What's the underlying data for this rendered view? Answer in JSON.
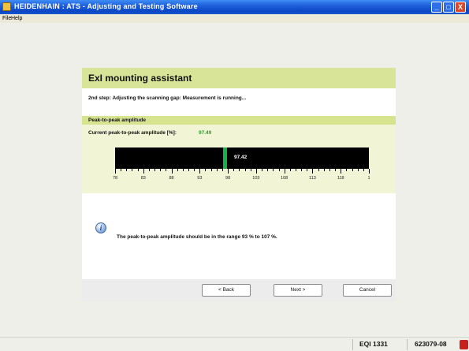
{
  "window": {
    "title": "HEIDENHAIN : ATS - Adjusting and Testing Software",
    "controls": {
      "minimize": "_",
      "maximize": "□",
      "close": "X"
    }
  },
  "menu": {
    "items": [
      "File",
      "Help"
    ]
  },
  "dialog": {
    "title": "ExI mounting assistant",
    "step_text": "2nd step: Adjusting the scanning gap: Measurement is running...",
    "amplitude": {
      "section_title": "Peak-to-peak amplitude",
      "current_label": "Current peak-to-peak amplitude [%]:",
      "current_value": "97.49",
      "gauge": {
        "marker_label": "97.42",
        "marker_value": 97.42,
        "min": 78,
        "max": 123,
        "tick_labels": [
          "78",
          "83",
          "88",
          "93",
          "98",
          "103",
          "108",
          "113",
          "118",
          "1"
        ],
        "marker_color": "#15b24a"
      }
    },
    "info": {
      "icon": "info-icon",
      "message": "The peak-to-peak amplitude should be in the range 93 % to 107 %."
    },
    "buttons": {
      "back": "< Back",
      "next": "Next >",
      "cancel": "Cancel"
    }
  },
  "status_bar": {
    "device": "EQI 1331",
    "id": "623079-08"
  },
  "colors": {
    "header": "#d8e598",
    "section": "#f1f5d6",
    "accent_value": "#2aa12a"
  }
}
